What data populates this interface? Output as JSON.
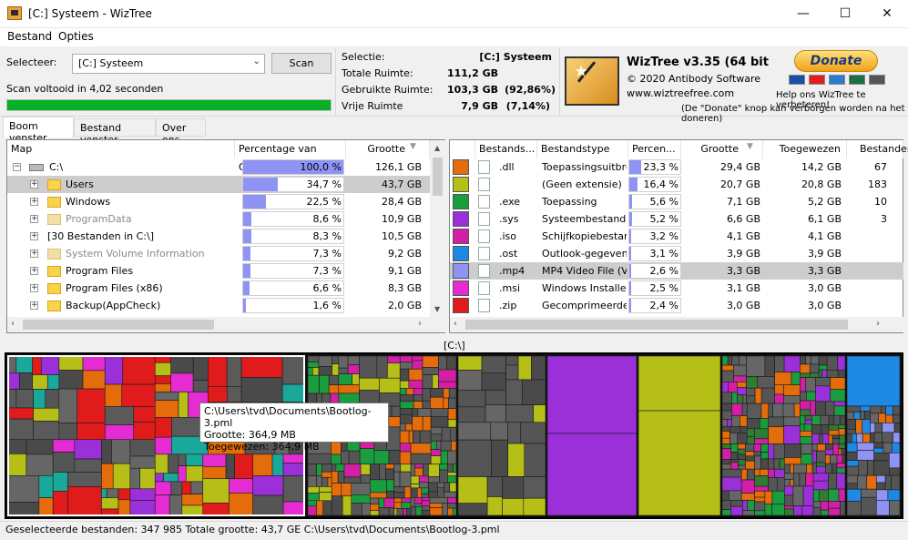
{
  "window": {
    "title": "[C:] Systeem - WizTree",
    "minimize": "—",
    "maximize": "☐",
    "close": "✕"
  },
  "menu": [
    "Bestand",
    "Opties"
  ],
  "selector": {
    "label": "Selecteer:",
    "value": "[C:] Systeem",
    "scan_button": "Scan",
    "status": "Scan voltooid in 4,02 seconden",
    "progress": 1.0
  },
  "info": {
    "selection_label": "Selectie:",
    "selection_value": "[C:]  Systeem",
    "rows": [
      {
        "label": "Totale Ruimte:",
        "value": "111,2 GB",
        "pct": ""
      },
      {
        "label": "Gebruikte Ruimte:",
        "value": "103,3 GB",
        "pct": "(92,86%)"
      },
      {
        "label": "Vrije Ruimte",
        "value": "7,9 GB",
        "pct": "(7,14%)"
      }
    ]
  },
  "about": {
    "title": "WizTree v3.35 (64 bit)",
    "copyright": "© 2020 Antibody Software",
    "url": "www.wiztreefree.com"
  },
  "donate": {
    "button": "Donate",
    "help": "Help ons WizTree te verbeteren!",
    "note": "(De \"Donate\" knop kan verborgen worden na het doneren)",
    "cards": [
      "#1a4fa3",
      "#e31b23",
      "#2a7bd1",
      "#1f6e43",
      "#555555"
    ]
  },
  "tabs": [
    "Boom venster",
    "Bestand venster",
    "Over ons"
  ],
  "tree": {
    "headers": {
      "map": "Map",
      "pct": "Percentage van Ouder",
      "size": "Grootte"
    },
    "rows": [
      {
        "name": "C:\\",
        "pct": "100,0 %",
        "pct_value": 100.0,
        "size": "126,1 GB",
        "icon": "drive-icon",
        "level": 0,
        "grey": false
      },
      {
        "name": "Users",
        "pct": "34,7 %",
        "pct_value": 34.7,
        "size": "43,7 GB",
        "icon": "folder-icon",
        "level": 1,
        "grey": false,
        "selected": true
      },
      {
        "name": "Windows",
        "pct": "22,5 %",
        "pct_value": 22.5,
        "size": "28,4 GB",
        "icon": "folder-icon",
        "level": 1,
        "grey": false
      },
      {
        "name": "ProgramData",
        "pct": "8,6 %",
        "pct_value": 8.6,
        "size": "10,9 GB",
        "icon": "folder-icon",
        "level": 1,
        "grey": true
      },
      {
        "name": "[30 Bestanden in C:\\]",
        "pct": "8,3 %",
        "pct_value": 8.3,
        "size": "10,5 GB",
        "icon": "",
        "level": 1,
        "grey": false
      },
      {
        "name": "System Volume Information",
        "pct": "7,3 %",
        "pct_value": 7.3,
        "size": "9,2 GB",
        "icon": "gear-folder-icon",
        "level": 1,
        "grey": true
      },
      {
        "name": "Program Files",
        "pct": "7,3 %",
        "pct_value": 7.3,
        "size": "9,1 GB",
        "icon": "folder-icon",
        "level": 1,
        "grey": false
      },
      {
        "name": "Program Files (x86)",
        "pct": "6,6 %",
        "pct_value": 6.6,
        "size": "8,3 GB",
        "icon": "folder-icon",
        "level": 1,
        "grey": false
      },
      {
        "name": "Backup(AppCheck)",
        "pct": "1,6 %",
        "pct_value": 1.6,
        "size": "2,0 GB",
        "icon": "folder-icon",
        "level": 1,
        "grey": false
      }
    ]
  },
  "types": {
    "headers": {
      "ext": "Bestands...",
      "type": "Bestandstype",
      "pct": "Percen...",
      "size": "Grootte",
      "alloc": "Toegewezen",
      "files": "Bestanden"
    },
    "rows": [
      {
        "color": "#e46c0a",
        "ext": ".dll",
        "type": "Toepassingsuitbrei",
        "pct": "23,3 %",
        "pct_value": 23.3,
        "size": "29,4 GB",
        "alloc": "14,2 GB",
        "files": "67"
      },
      {
        "color": "#b5bf17",
        "ext": "",
        "type": "(Geen extensie)",
        "pct": "16,4 %",
        "pct_value": 16.4,
        "size": "20,7 GB",
        "alloc": "20,8 GB",
        "files": "183"
      },
      {
        "color": "#1a9d3f",
        "ext": ".exe",
        "type": "Toepassing",
        "pct": "5,6 %",
        "pct_value": 5.6,
        "size": "7,1 GB",
        "alloc": "5,2 GB",
        "files": "10"
      },
      {
        "color": "#9b30d9",
        "ext": ".sys",
        "type": "Systeembestand",
        "pct": "5,2 %",
        "pct_value": 5.2,
        "size": "6,6 GB",
        "alloc": "6,1 GB",
        "files": "3"
      },
      {
        "color": "#d21fa6",
        "ext": ".iso",
        "type": "Schijfkopiebestand",
        "pct": "3,2 %",
        "pct_value": 3.2,
        "size": "4,1 GB",
        "alloc": "4,1 GB",
        "files": ""
      },
      {
        "color": "#1e88e5",
        "ext": ".ost",
        "type": "Outlook-gegevens",
        "pct": "3,1 %",
        "pct_value": 3.1,
        "size": "3,9 GB",
        "alloc": "3,9 GB",
        "files": ""
      },
      {
        "color": "#8f93f4",
        "ext": ".mp4",
        "type": "MP4 Video File (VLC",
        "pct": "2,6 %",
        "pct_value": 2.6,
        "size": "3,3 GB",
        "alloc": "3,3 GB",
        "files": "",
        "selected": true
      },
      {
        "color": "#e52bd2",
        "ext": ".msi",
        "type": "Windows Installer-",
        "pct": "2,5 %",
        "pct_value": 2.5,
        "size": "3,1 GB",
        "alloc": "3,0 GB",
        "files": ""
      },
      {
        "color": "#e01b1b",
        "ext": ".zip",
        "type": "Gecomprimeerde (",
        "pct": "2,4 %",
        "pct_value": 2.4,
        "size": "3,0 GB",
        "alloc": "3,0 GB",
        "files": ""
      }
    ]
  },
  "treemap": {
    "path": "[C:\\]",
    "tooltip": {
      "path": "C:\\Users\\tvd\\Documents\\Bootlog-3.pml",
      "size": "Grootte: 364,9 MB",
      "alloc": "Toegewezen: 364,9 MB"
    }
  },
  "status": "Geselecteerde bestanden: 347 985  Totale grootte: 43,7 GE  C:\\Users\\tvd\\Documents\\Bootlog-3.pml"
}
